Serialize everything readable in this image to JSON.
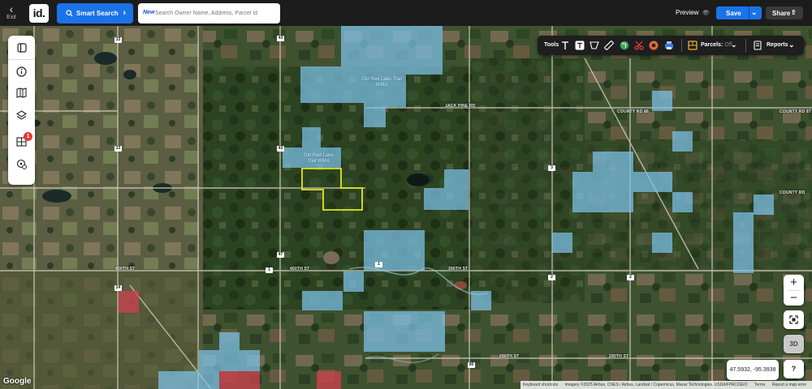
{
  "topbar": {
    "exit_label": "Exit",
    "logo_text": "id.",
    "smart_search_label": "Smart Search",
    "search_new_tag": "New",
    "search_placeholder": "Search Owner Name, Address, Parcel Id",
    "preview_label": "Preview",
    "save_label": "Save",
    "share_label": "Share"
  },
  "tools": {
    "label": "Tools",
    "icons": [
      "text-icon",
      "text-box-icon",
      "polygon-icon",
      "ruler-icon",
      "globe-icon",
      "scissors-icon",
      "record-icon",
      "print-icon",
      "parcels-icon",
      "reports-icon"
    ],
    "parcels_label": "Parcels:",
    "parcels_state": "Off",
    "reports_label": "Reports"
  },
  "left_rail": {
    "items": [
      "sidebar-toggle",
      "info",
      "map",
      "layers",
      "grid-tools",
      "location-settings"
    ],
    "badge_count": "1"
  },
  "map": {
    "wma_labels": [
      "Old Red Lake Trail WMA",
      "Old Red Lake Trail WMA"
    ],
    "road_labels": {
      "jack_pine": "JACK PINE RD",
      "county_rd_1": "COUNTY RD 86",
      "county_rd_2": "COUNTY RD 87",
      "county_rd_3": "COUNTY RD",
      "st400": "400TH ST",
      "st390": "390TH ST",
      "st290": "290TH ST",
      "st290b": "290TH ST",
      "st400b": "400TH ST"
    },
    "shields": [
      "33",
      "33",
      "43",
      "43",
      "47",
      "1",
      "24",
      "3",
      "2",
      "2",
      "90",
      "1"
    ],
    "colors": {
      "wma_fill": "#7ec3ea",
      "parcel_outline": "#e6e61a",
      "red_parcel": "#d0424f"
    }
  },
  "controls": {
    "zoom_in": "+",
    "zoom_out": "−",
    "three_d": "3D",
    "help": "?",
    "coordinates": "47.5932, -95.3938"
  },
  "footer": {
    "google": "Google",
    "attribution": [
      "Keyboard shortcuts",
      "Imagery ©2025 Airbus, CNES / Airbus, Landsat / Copernicus, Maxar Technologies, USDA/FPAC/GEO",
      "Terms",
      "Report a map error"
    ]
  }
}
